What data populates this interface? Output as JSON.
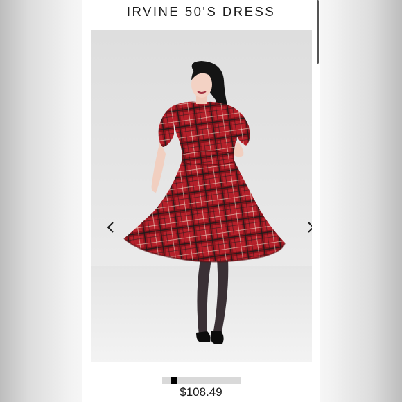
{
  "product": {
    "title": "IRVINE 50'S DRESS",
    "price": "$108.49"
  },
  "gallery": {
    "prev_icon": "chevron-left-icon",
    "next_icon": "chevron-right-icon",
    "active_slide": 1
  },
  "colors": {
    "dress_red": "#b5202a",
    "background": "#ffffff",
    "text": "#1b1b1b"
  }
}
